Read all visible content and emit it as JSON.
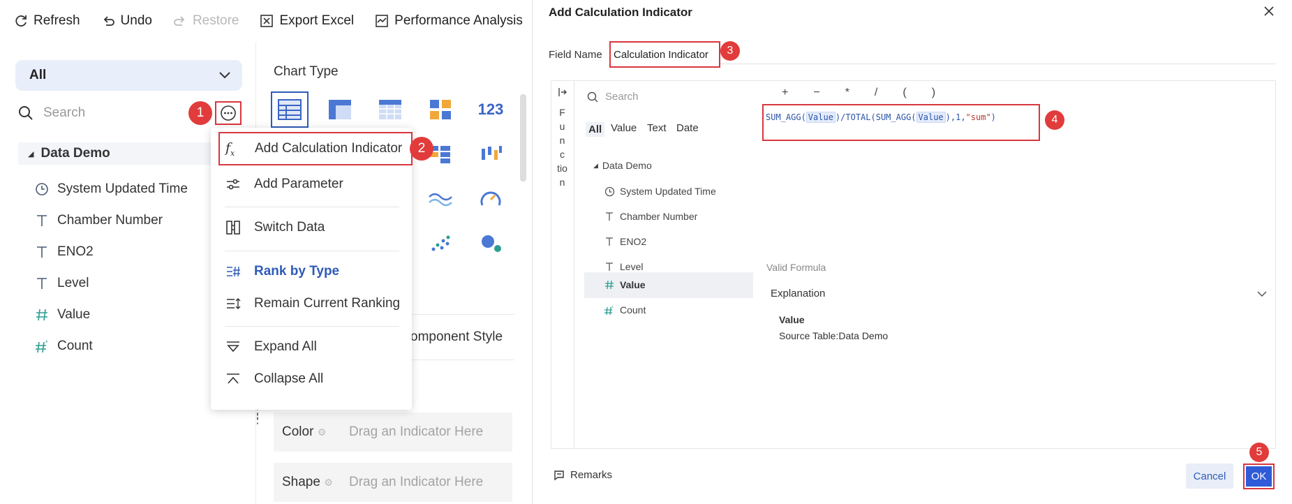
{
  "toolbar": {
    "refresh": "Refresh",
    "undo": "Undo",
    "restore": "Restore",
    "export_excel": "Export Excel",
    "performance": "Performance Analysis"
  },
  "left": {
    "dataset_select": "All",
    "search_placeholder": "Search",
    "tree_root": "Data Demo",
    "fields": [
      {
        "name": "System Updated Time",
        "icon": "clock-icon"
      },
      {
        "name": "Chamber Number",
        "icon": "text-type-icon"
      },
      {
        "name": "ENO2",
        "icon": "text-type-icon"
      },
      {
        "name": "Level",
        "icon": "text-type-icon"
      },
      {
        "name": "Value",
        "icon": "number-type-icon"
      },
      {
        "name": "Count",
        "icon": "calc-number-icon"
      }
    ]
  },
  "menu": {
    "items": [
      {
        "label": "Add Calculation Indicator",
        "icon": "fx-icon"
      },
      {
        "label": "Add Parameter",
        "icon": "sliders-icon"
      },
      {
        "label": "Switch Data",
        "icon": "switch-icon"
      },
      {
        "label": "Rank by Type",
        "icon": "rank-type-icon"
      },
      {
        "label": "Remain Current Ranking",
        "icon": "rank-current-icon"
      },
      {
        "label": "Expand All",
        "icon": "expand-icon"
      },
      {
        "label": "Collapse All",
        "icon": "collapse-icon"
      }
    ]
  },
  "chart_panel": {
    "title": "Chart Type",
    "component_style": "omponent Style",
    "color_label": "Color",
    "shape_label": "Shape",
    "drop_placeholder": "Drag an Indicator Here",
    "icon_text_123": "123"
  },
  "markers": [
    "1",
    "2",
    "3",
    "4",
    "5"
  ],
  "modal": {
    "title": "Add Calculation Indicator",
    "field_name_label": "Field Name",
    "field_name_value": "Calculation Indicator",
    "function_strip": [
      "F",
      "u",
      "n",
      "c",
      "tio",
      "n"
    ],
    "search_placeholder": "Search",
    "tabs": [
      "All",
      "Value",
      "Text",
      "Date"
    ],
    "tree_root": "Data Demo",
    "fields": [
      {
        "name": "System Updated Time",
        "icon": "clock-icon"
      },
      {
        "name": "Chamber Number",
        "icon": "text-type-icon"
      },
      {
        "name": "ENO2",
        "icon": "text-type-icon"
      },
      {
        "name": "Level",
        "icon": "text-type-icon"
      },
      {
        "name": "Value",
        "icon": "number-type-icon"
      },
      {
        "name": "Count",
        "icon": "calc-number-icon"
      }
    ],
    "operators": [
      "+",
      "−",
      "*",
      "/",
      "(",
      ")"
    ],
    "formula": {
      "p1": "SUM_AGG(",
      "t1": "Value",
      "p2": ")/TOTAL(SUM_AGG(",
      "t2": "Value",
      "p3": "),1,",
      "s1": "\"sum\"",
      "p4": ")"
    },
    "valid_text": "Valid Formula",
    "explanation_label": "Explanation",
    "explanation_title": "Value",
    "explanation_source": "Source Table:Data Demo",
    "remarks": "Remarks",
    "cancel": "Cancel",
    "ok": "OK"
  },
  "colors": {
    "accent": "#2f5bb8",
    "marker_red": "#e23b3b",
    "highlight_border": "#d9363e"
  }
}
